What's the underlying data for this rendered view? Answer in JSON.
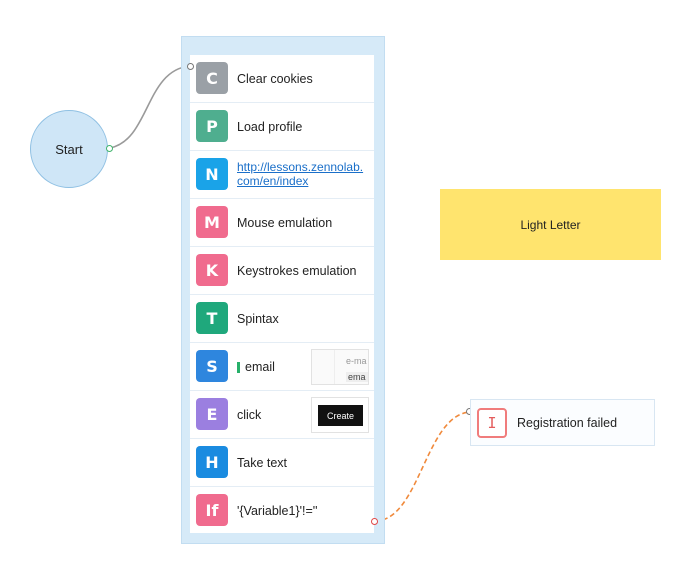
{
  "start": {
    "label": "Start"
  },
  "actions": [
    {
      "letter": "C",
      "label": "Clear cookies",
      "color": "#9aa0a6"
    },
    {
      "letter": "P",
      "label": "Load profile",
      "color": "#4fae8f"
    },
    {
      "letter": "N",
      "label": "http://lessons.zennolab.com/en/index",
      "color": "#1aa3e8"
    },
    {
      "letter": "M",
      "label": "Mouse emulation",
      "color": "#f06b8e"
    },
    {
      "letter": "K",
      "label": "Keystrokes emulation",
      "color": "#f06b8e"
    },
    {
      "letter": "T",
      "label": "Spintax",
      "color": "#1fa87c"
    },
    {
      "letter": "S",
      "label": "email",
      "color": "#2e86de",
      "thumb_placeholder": "e-ma",
      "thumb_value": "ema"
    },
    {
      "letter": "E",
      "label": "click",
      "color": "#9b7fe0",
      "thumb_button": "Create"
    },
    {
      "letter": "H",
      "label": "Take text",
      "color": "#1a8be0"
    },
    {
      "letter": "If",
      "label": "'{Variable1}'!=''",
      "color": "#f06b8e"
    }
  ],
  "note": {
    "text": "Light Letter",
    "color": "#ffe46e"
  },
  "failure": {
    "icon_letter": "I",
    "label": "Registration failed"
  }
}
